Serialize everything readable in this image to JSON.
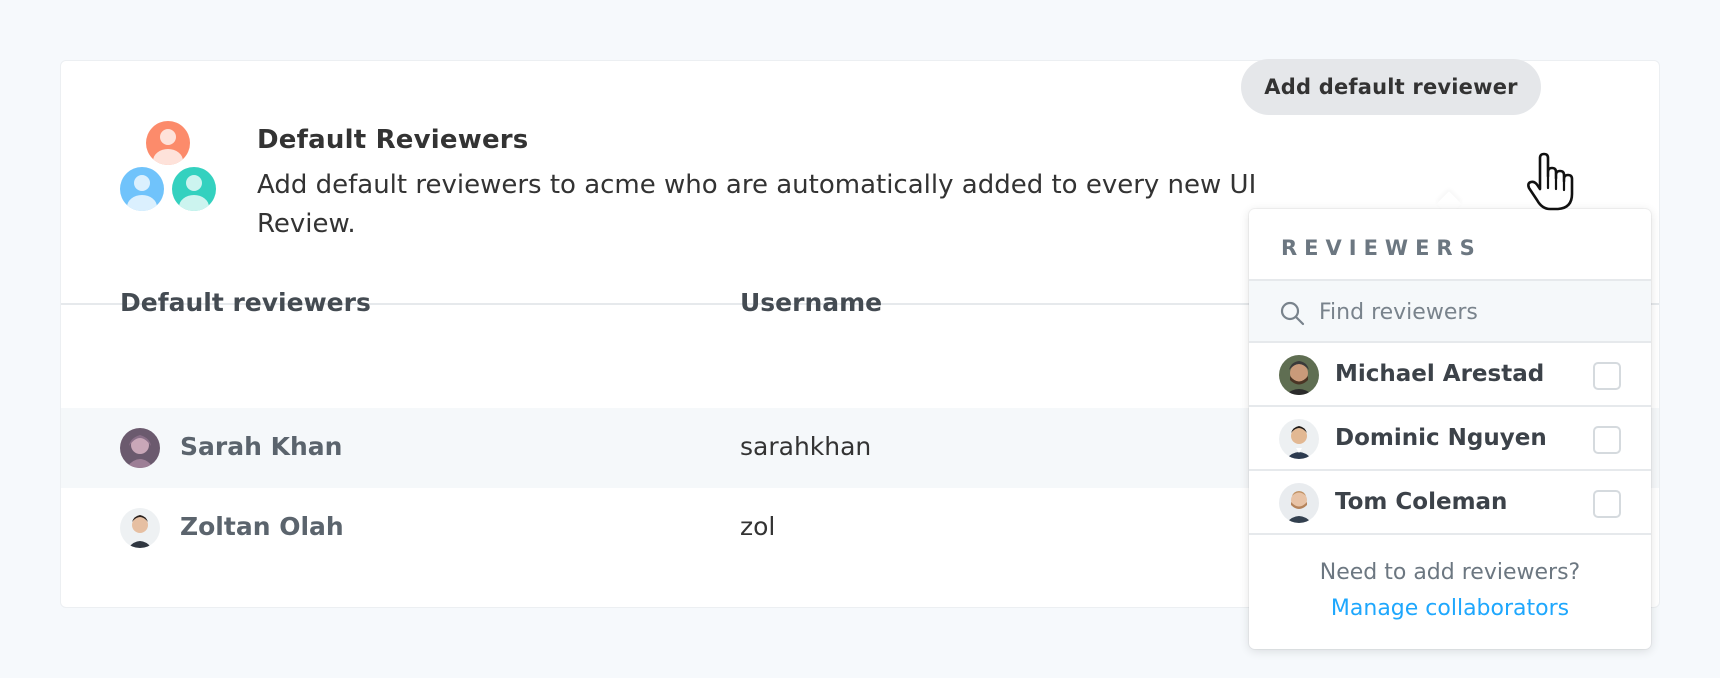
{
  "header": {
    "title": "Default Reviewers",
    "description": "Add default reviewers to acme who are automatically added to every new UI Review.",
    "add_button_label": "Add default reviewer"
  },
  "table": {
    "columns": [
      "Default reviewers",
      "Username"
    ],
    "rows": [
      {
        "name": "Sarah Khan",
        "username": "sarahkhan"
      },
      {
        "name": "Zoltan Olah",
        "username": "zol"
      }
    ]
  },
  "dropdown": {
    "title": "REVIEWERS",
    "search_placeholder": "Find reviewers",
    "items": [
      {
        "name": "Michael Arestad",
        "checked": false
      },
      {
        "name": "Dominic Nguyen",
        "checked": false
      },
      {
        "name": "Tom Coleman",
        "checked": false
      }
    ],
    "footer_text": "Need to add reviewers?",
    "footer_link": "Manage collaborators"
  },
  "colors": {
    "background": "#f6f9fc",
    "card": "#ffffff",
    "link": "#1ea7fd",
    "button": "#e5e7ea",
    "avatar_orange": "#fc8b6b",
    "avatar_blue": "#70c3fb",
    "avatar_teal": "#34d1bf"
  },
  "icons": {
    "group_avatar": "user-group-icon",
    "search": "search-icon",
    "cursor": "hand-pointer-icon"
  }
}
